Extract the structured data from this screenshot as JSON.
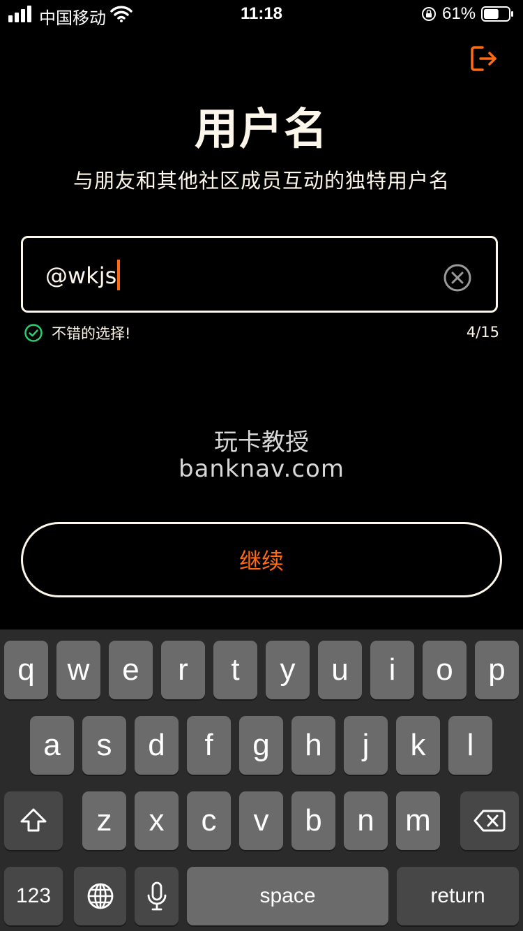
{
  "status_bar": {
    "carrier": "中国移动",
    "time": "11:18",
    "battery_percent": "61%",
    "battery_level": 0.61
  },
  "header": {
    "title": "用户名",
    "subtitle": "与朋友和其他社区成员互动的独特用户名"
  },
  "username_input": {
    "value": "@wkjs",
    "validation_message": "不错的选择!",
    "counter": "4/15"
  },
  "watermark": {
    "line1": "玩卡教授",
    "line2": "banknav.com"
  },
  "continue_button": {
    "label": "继续"
  },
  "keyboard": {
    "row1": [
      "q",
      "w",
      "e",
      "r",
      "t",
      "y",
      "u",
      "i",
      "o",
      "p"
    ],
    "row2": [
      "a",
      "s",
      "d",
      "f",
      "g",
      "h",
      "j",
      "k",
      "l"
    ],
    "row3": [
      "z",
      "x",
      "c",
      "v",
      "b",
      "n",
      "m"
    ],
    "numbers_label": "123",
    "space_label": "space",
    "return_label": "return"
  },
  "colors": {
    "accent": "#ff6a13",
    "text": "#fdf6ea",
    "success": "#2ecc71"
  }
}
